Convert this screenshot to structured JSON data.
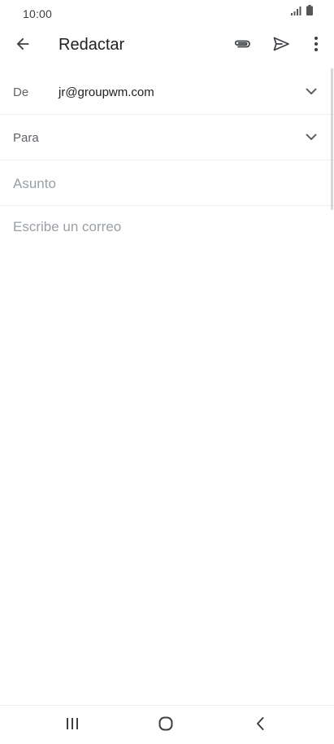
{
  "status_bar": {
    "time": "10:00",
    "icons": [
      "signal-icon",
      "battery-icon"
    ]
  },
  "app_bar": {
    "title": "Redactar",
    "icons": [
      "arrow-back-icon",
      "paperclip-icon",
      "send-icon",
      "more-vert-icon"
    ]
  },
  "compose": {
    "from_label": "De",
    "from_value": "jr@groupwm.com",
    "to_label": "Para",
    "to_value": "",
    "subject_value": "",
    "subject_placeholder": "Asunto",
    "body_value": "",
    "body_placeholder": "Escribe un correo"
  },
  "nav_bar": {
    "icons": [
      "recents-icon",
      "home-icon",
      "back-icon"
    ]
  },
  "colors": {
    "text_primary": "#202124",
    "text_secondary": "#5f6368",
    "placeholder": "#9aa0a6",
    "divider": "#eeeeee",
    "icon": "#5f6368"
  }
}
